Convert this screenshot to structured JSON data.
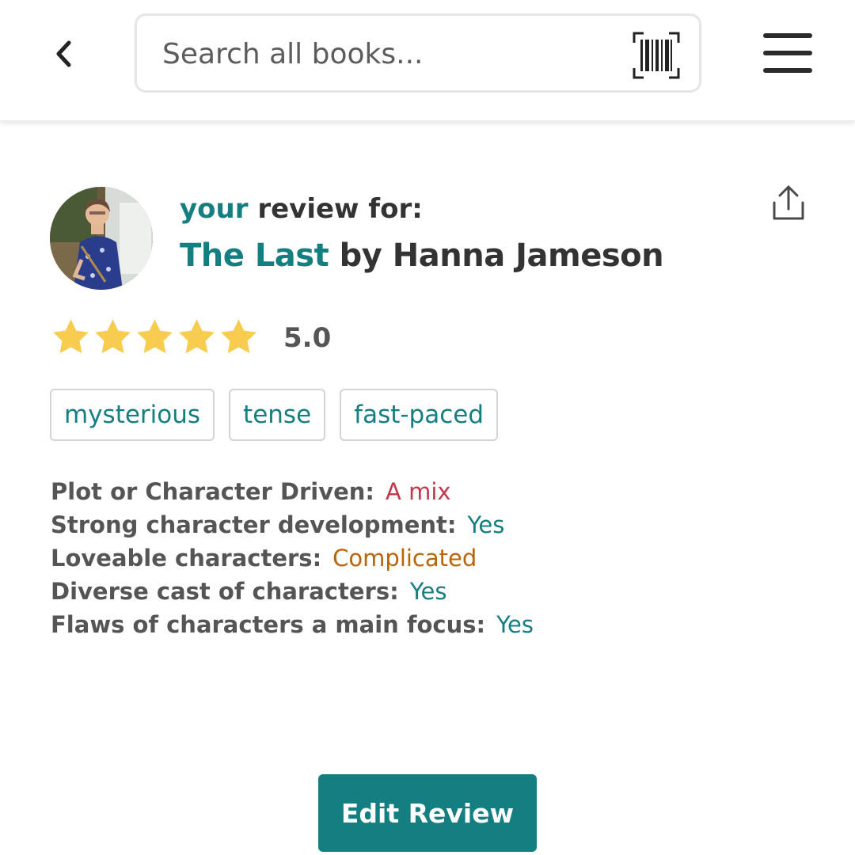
{
  "header": {
    "search_placeholder": "Search all books...",
    "back_icon": "chevron-left-icon",
    "barcode_icon": "barcode-scan-icon",
    "menu_icon": "hamburger-menu-icon"
  },
  "review": {
    "owner_word": "your",
    "review_for_text": "review for:",
    "book_title": "The Last",
    "by_text": "by Hanna Jameson",
    "share_icon": "share-icon",
    "rating_value": "5.0",
    "rating_stars": 5,
    "rating_max": 5,
    "tags": [
      "mysterious",
      "tense",
      "fast-paced"
    ],
    "attributes": [
      {
        "label": "Plot or Character Driven:",
        "value": "A mix",
        "color": "#c0394a"
      },
      {
        "label": "Strong character development:",
        "value": "Yes",
        "color": "#157e80"
      },
      {
        "label": "Loveable characters:",
        "value": "Complicated",
        "color": "#b8650a"
      },
      {
        "label": "Diverse cast of characters:",
        "value": "Yes",
        "color": "#157e80"
      },
      {
        "label": "Flaws of characters a main focus:",
        "value": "Yes",
        "color": "#157e80"
      }
    ],
    "edit_button_label": "Edit Review"
  },
  "colors": {
    "accent": "#157e80",
    "star": "#f7cc4f",
    "text": "#333333"
  }
}
